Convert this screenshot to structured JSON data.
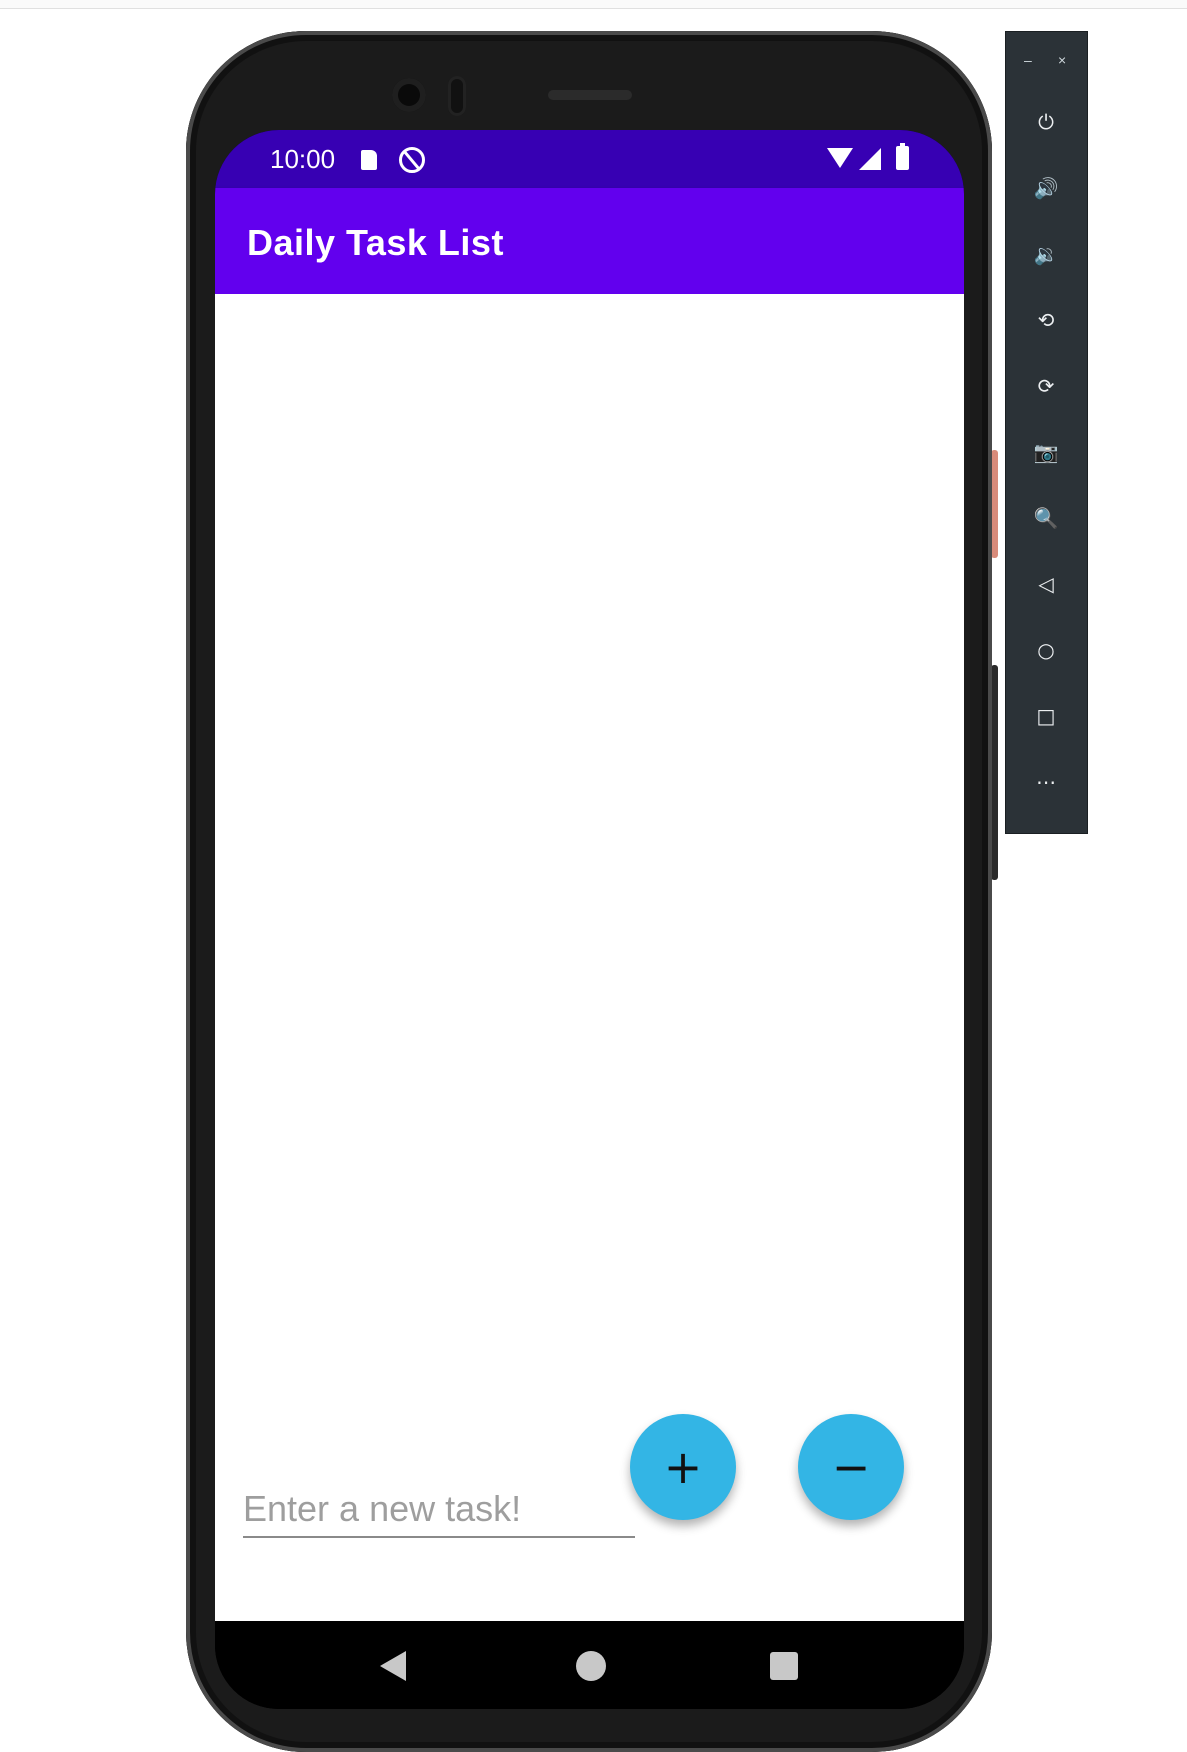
{
  "status_bar": {
    "time": "10:00"
  },
  "app_bar": {
    "title": "Daily Task List",
    "color": "#6200ee",
    "status_color": "#3700b3"
  },
  "task_input": {
    "placeholder": "Enter a new task!",
    "value": ""
  },
  "fabs": {
    "add_label": "+",
    "remove_label": "−",
    "color": "#33b5e5"
  },
  "emulator_toolbar": {
    "minimize_label": "–",
    "close_label": "×",
    "buttons": [
      {
        "name": "power",
        "glyph": "⏻"
      },
      {
        "name": "volume-up",
        "glyph": "🔊"
      },
      {
        "name": "volume-down",
        "glyph": "🔉"
      },
      {
        "name": "rotate-left",
        "glyph": "⟲"
      },
      {
        "name": "rotate-right",
        "glyph": "⟳"
      },
      {
        "name": "screenshot",
        "glyph": "📷"
      },
      {
        "name": "zoom",
        "glyph": "🔍"
      },
      {
        "name": "back",
        "glyph": "◁"
      },
      {
        "name": "home",
        "glyph": "○"
      },
      {
        "name": "overview",
        "glyph": "□"
      },
      {
        "name": "more",
        "glyph": "⋯"
      }
    ]
  }
}
